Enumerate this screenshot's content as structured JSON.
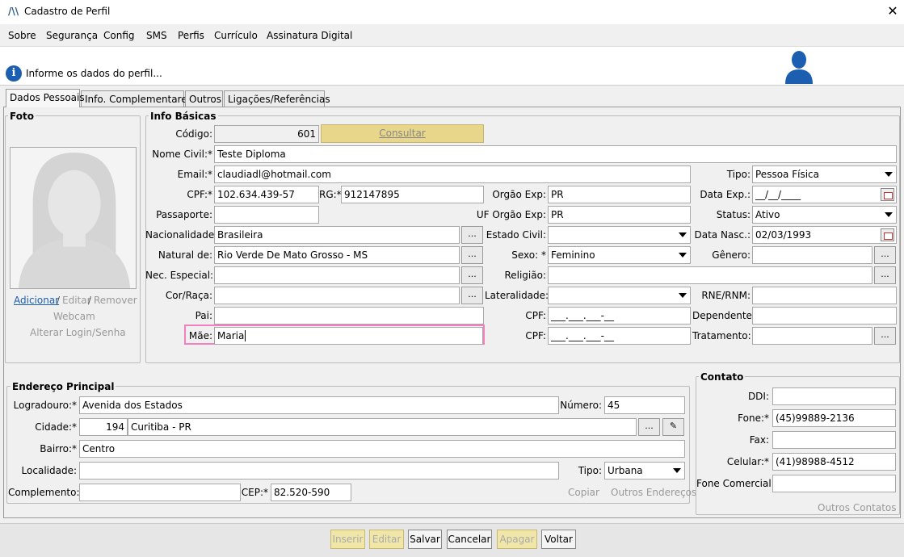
{
  "window": {
    "title": "Cadastro de Perfil",
    "logo": "/\\\\"
  },
  "menu": [
    "Sobre",
    "Segurança",
    "Config",
    "SMS",
    "Perfis",
    "Currículo",
    "Assinatura Digital"
  ],
  "info": {
    "text": "Informe os dados do perfil..."
  },
  "tabs": [
    "Dados Pessoais",
    "Info. Complementares",
    "Outros",
    "Ligações/Referências"
  ],
  "foto": {
    "title": "Foto",
    "adicionar": "Adicionar",
    "sep1": "/",
    "editar": "Editar",
    "sep2": "/",
    "remover": "Remover",
    "webcam": "Webcam",
    "alterar_login": "Alterar Login/Senha"
  },
  "info_basicas": {
    "title": "Info Básicas",
    "codigo": {
      "label": "Código:",
      "value": "601"
    },
    "consultar": "Consultar",
    "nome_civil": {
      "label": "Nome Civil:*",
      "value": "Teste Diploma"
    },
    "email": {
      "label": "Email:*",
      "value": "claudiadl@hotmail.com"
    },
    "tipo": {
      "label": "Tipo:",
      "value": "Pessoa Física"
    },
    "cpf": {
      "label": "CPF:*",
      "value": "102.634.439-57"
    },
    "rg": {
      "label": "RG:*",
      "value": "912147895"
    },
    "orgao_exp": {
      "label": "Orgão Exp:",
      "value": "PR"
    },
    "data_exp": {
      "label": "Data Exp.:",
      "value": "__/__/____"
    },
    "passaporte": {
      "label": "Passaporte:",
      "value": ""
    },
    "uf_orgao_exp": {
      "label": "UF Orgão Exp:",
      "value": "PR"
    },
    "status": {
      "label": "Status:",
      "value": "Ativo"
    },
    "nacionalidade": {
      "label": "Nacionalidade:",
      "value": "Brasileira"
    },
    "estado_civil": {
      "label": "Estado Civil:",
      "value": ""
    },
    "data_nasc": {
      "label": "Data Nasc.:",
      "value": "02/03/1993"
    },
    "natural_de": {
      "label": "Natural de:",
      "value": "Rio Verde De Mato Grosso - MS"
    },
    "sexo": {
      "label": "Sexo: *",
      "value": "Feminino"
    },
    "genero": {
      "label": "Gênero:",
      "value": ""
    },
    "nec_especial": {
      "label": "Nec. Especial:",
      "value": ""
    },
    "religiao": {
      "label": "Religião:",
      "value": ""
    },
    "cor_raca": {
      "label": "Cor/Raça:",
      "value": ""
    },
    "lateralidade": {
      "label": "Lateralidade:",
      "value": ""
    },
    "rne_rnm": {
      "label": "RNE/RNM:",
      "value": ""
    },
    "pai": {
      "label": "Pai:",
      "value": ""
    },
    "cpf_pai": {
      "label": "CPF:",
      "value": "___.___.___-__"
    },
    "dependentes": {
      "label": "Dependentes:",
      "value": ""
    },
    "mae": {
      "label": "Mãe:",
      "value": "Maria"
    },
    "cpf_mae": {
      "label": "CPF:",
      "value": "___.___.___-__"
    },
    "tratamento": {
      "label": "Tratamento:",
      "value": ""
    },
    "ellipsis": "..."
  },
  "endereco": {
    "title": "Endereço Principal",
    "logradouro": {
      "label": "Logradouro:*",
      "value": "Avenida dos Estados"
    },
    "numero": {
      "label": "Número:",
      "value": "45"
    },
    "cidade": {
      "label": "Cidade:*",
      "code": "194",
      "value": "Curitiba - PR"
    },
    "bairro": {
      "label": "Bairro:*",
      "value": "Centro"
    },
    "localidade": {
      "label": "Localidade:",
      "value": ""
    },
    "tipo": {
      "label": "Tipo:",
      "value": "Urbana"
    },
    "complemento": {
      "label": "Complemento:",
      "value": ""
    },
    "cep": {
      "label": "CEP:*",
      "value": "82.520-590"
    },
    "copiar": "Copiar",
    "outros_enderecos": "Outros Endereços"
  },
  "contato": {
    "title": "Contato",
    "ddi": {
      "label": "DDI:",
      "value": ""
    },
    "fone": {
      "label": "Fone:*",
      "value": "(45)99889-2136"
    },
    "fax": {
      "label": "Fax:",
      "value": ""
    },
    "celular": {
      "label": "Celular:*",
      "value": "(41)98988-4512"
    },
    "fone_comercial": {
      "label": "Fone Comercial:",
      "value": ""
    },
    "outros_contatos": "Outros Contatos"
  },
  "actions": [
    "Inserir",
    "Editar",
    "Salvar",
    "Cancelar",
    "Apagar",
    "Voltar"
  ],
  "colors": {
    "accent": "#1c5eb0",
    "focus_border": "#f080c0",
    "disabled_btn": "#f0e6a8"
  }
}
